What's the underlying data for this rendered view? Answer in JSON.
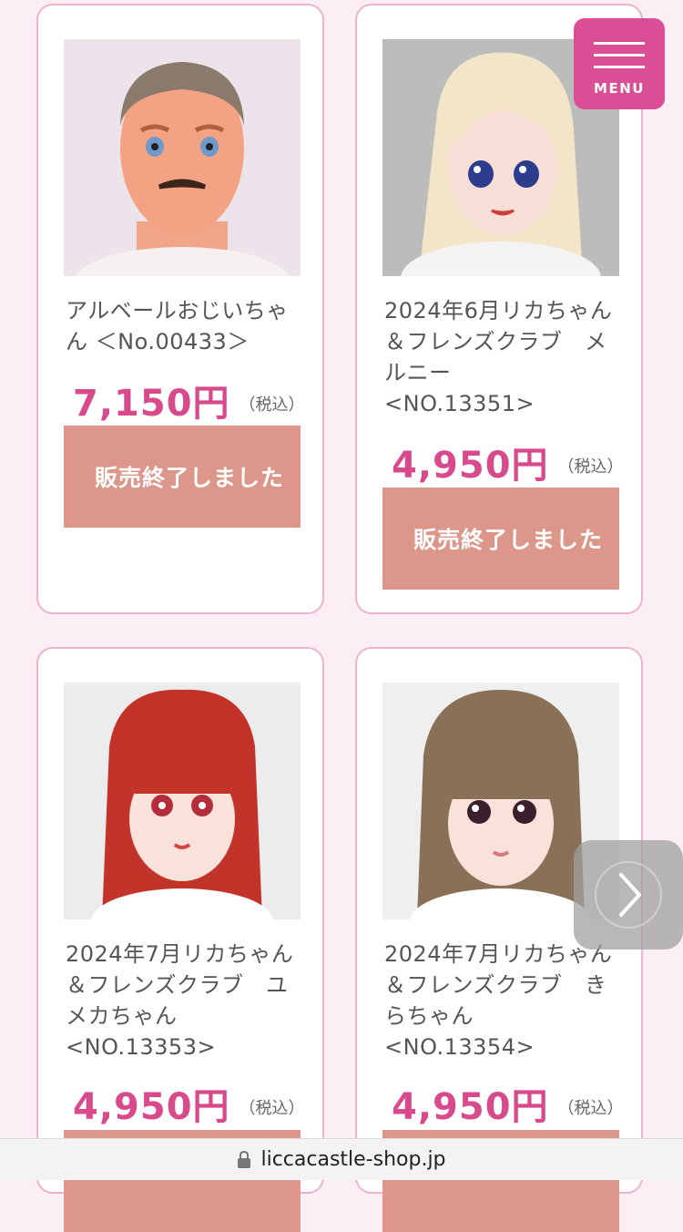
{
  "products": [
    {
      "name": "アルベールおじいちゃん ＜No.00433＞",
      "price": "7,150円",
      "tax_label": "（税込）",
      "status_button": "販売終了しました",
      "image": "doll-man-mustache"
    },
    {
      "name": "2024年6月リカちゃん＆フレンズクラブ　メルニー\n<NO.13351>",
      "price": "4,950円",
      "tax_label": "（税込）",
      "status_button": "販売終了しました",
      "image": "doll-blonde"
    },
    {
      "name": "2024年7月リカちゃん＆フレンズクラブ　ユメカちゃん\n<NO.13353>",
      "price": "4,950円",
      "tax_label": "（税込）",
      "status_button": "",
      "image": "doll-red-hair"
    },
    {
      "name": "2024年7月リカちゃん＆フレンズクラブ　きらちゃん\n<NO.13354>",
      "price": "4,950円",
      "tax_label": "（税込）",
      "status_button": "",
      "image": "doll-brown-hair"
    }
  ],
  "menu": {
    "label": "MENU",
    "icon": "hamburger-icon"
  },
  "carousel": {
    "next_icon": "chevron-right-icon"
  },
  "browser": {
    "url": "liccacastle-shop.jp",
    "icon": "lock-icon"
  },
  "colors": {
    "background": "#fbeef4",
    "card_border": "#ecb3cc",
    "price": "#d84a8c",
    "sold_button": "#dc968a",
    "menu_button": "#d94e94"
  }
}
